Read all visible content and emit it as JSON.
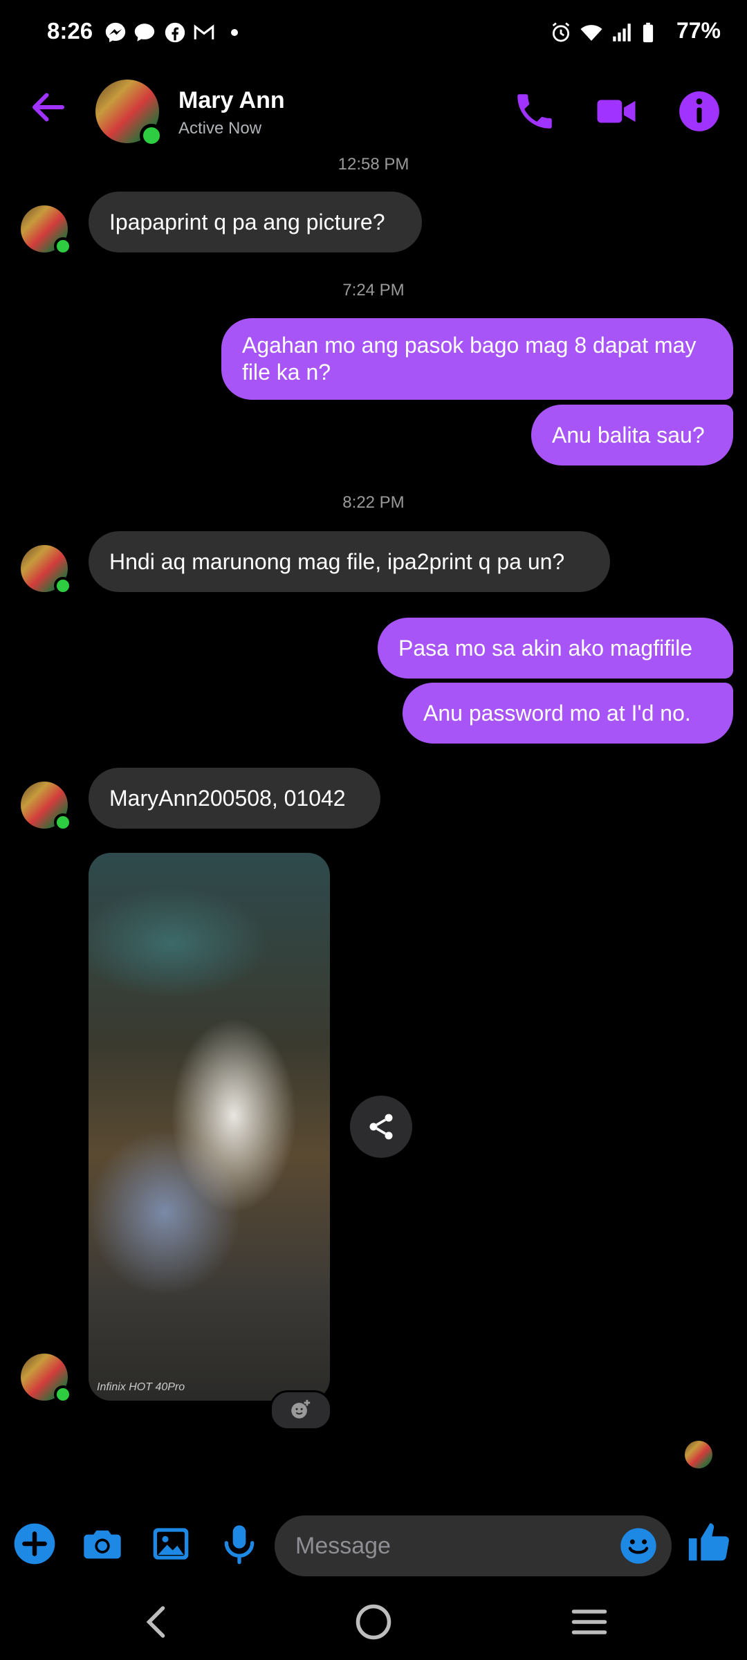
{
  "status_bar": {
    "time": "8:26",
    "battery": "77%",
    "notification_icons": [
      "messenger-icon",
      "chat-icon",
      "facebook-icon",
      "gmail-icon",
      "dot-icon"
    ],
    "system_icons": [
      "alarm-icon",
      "wifi-icon",
      "signal-icon",
      "battery-icon"
    ]
  },
  "header": {
    "contact_name": "Mary Ann",
    "contact_status": "Active Now",
    "actions": [
      "phone-icon",
      "video-icon",
      "info-icon"
    ],
    "accent_color": "#a033ff"
  },
  "messages": {
    "ts1": "12:58 PM",
    "m1": "Ipapaprint q pa ang picture?",
    "ts2": "7:24 PM",
    "m2": "Agahan mo ang pasok bago mag 8 dapat may file ka n?",
    "m3": "Anu balita sau?",
    "ts3": "8:22 PM",
    "m4": "Hndi aq marunong mag file, ipa2print q pa un?",
    "m5": "Pasa mo sa akin ako magfifile",
    "m6": "Anu password  mo at I'd no.",
    "m7": "MaryAnn200508, 01042",
    "photo_watermark": "Infinix HOT 40Pro"
  },
  "colors": {
    "outgoing_bubble": "#a855f7",
    "incoming_bubble": "#303030",
    "composer_icons": "#1e88e5",
    "online": "#2ecc40"
  },
  "composer": {
    "placeholder": "Message",
    "icons": [
      "plus-icon",
      "camera-icon",
      "gallery-icon",
      "mic-icon",
      "emoji-icon",
      "thumbs-up-icon"
    ]
  },
  "nav_bar": {
    "buttons": [
      "back-nav-icon",
      "home-nav-icon",
      "recents-nav-icon"
    ]
  }
}
